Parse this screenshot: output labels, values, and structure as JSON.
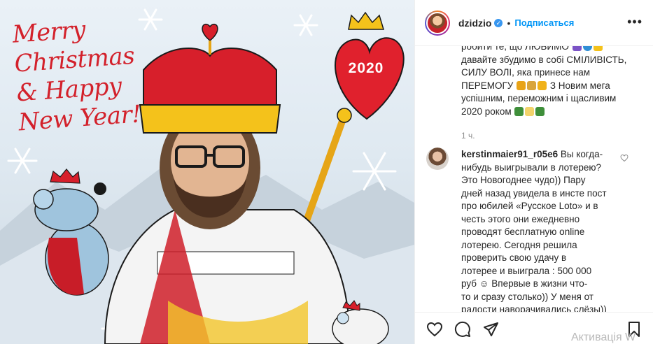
{
  "photo": {
    "greeting_lines": [
      "Merry",
      "Christmas",
      "& Happy",
      "New Year!"
    ],
    "year": "2020"
  },
  "post": {
    "username": "dzidzio",
    "verified": true,
    "follow_label": "Подписаться",
    "more_label": "•••",
    "caption_lines": [
      "робити те, що ЛЮБИМО",
      "давайте збудимо в собі СМІЛИВІСТЬ,",
      "СИЛУ ВОЛІ, яка принесе нам",
      "ПЕРЕМОГУ",
      "успішним, переможним і щасливим",
      "2020 роком"
    ],
    "caption_line4_tail": "З Новим мега",
    "timestamp": "1 ч.",
    "comment": {
      "username": "kerstinmaier91_r05e6",
      "first_line_tail": "Вы когда-",
      "lines": [
        "нибудь выигрывали в лотерею?",
        "Это Новогоднее чудо)) Пару",
        "дней назад увидела в инсте пост",
        "про юбилей «Русское Loto» и в",
        "честь этого они ежедневно",
        "проводят бесплатную online",
        "лотерею. Сегодня решила",
        "проверить свою удачу в",
        "лотерее и выиграла : 500 000",
        "руб ☺ Впервые в жизни что-",
        "то и сразу столько)) У меня от",
        "радости наворачивались слёзы))"
      ]
    }
  },
  "icons": {
    "like": "heart-icon",
    "comment": "comment-icon",
    "share": "share-icon",
    "save": "bookmark-icon",
    "more": "more-icon",
    "verified": "verified-icon"
  },
  "colors": {
    "accent": "#0095f6",
    "verified": "#3897f0",
    "greeting": "#d3212b",
    "muted": "#8e8e8e"
  },
  "watermark": "Активація W"
}
